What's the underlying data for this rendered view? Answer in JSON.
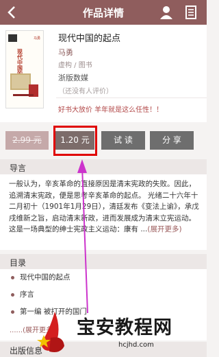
{
  "header": {
    "title": "作品详情"
  },
  "book": {
    "title": "现代中国的起点",
    "author": "马勇",
    "category": "虚构 / 图书",
    "publisher": "浙版数媒",
    "rating": "（还没有人评价）",
    "promo": "好书大放价 羊年就是这么任性！！",
    "cover_title": "现代中国的起点",
    "cover_author": "马勇"
  },
  "actions": {
    "original_price": "2.99 元",
    "price": "1.20 元",
    "try_read": "试 读",
    "share": "分 享"
  },
  "intro": {
    "heading": "导言",
    "text": "一般认为，辛亥革命的直接原因是清末宪政的失败。因此，追溯清末宪政，便是思考辛亥革命的起点。 光绪二十六年十二月初十（1901年1月29日），清廷发布《变法上谕》，承戊戌维新之旨，启动清末新政，进而发展成为清末立宪运动。这是一场典型的绅士宪政主义运动：康有 ...",
    "more": "(展开更多)"
  },
  "toc": {
    "heading": "目录",
    "items": [
      "现代中国的起点",
      "序言",
      "第一编 被打开的国门"
    ],
    "more": "......(展开更多)"
  },
  "publisher_info": {
    "heading": "出版信息"
  },
  "watermark": {
    "text": "宝安教程网",
    "url": "hcjhd.com"
  },
  "colors": {
    "header": "#8f5d5d",
    "highlight_box": "#e00000",
    "arrow": "#cc33cc"
  }
}
